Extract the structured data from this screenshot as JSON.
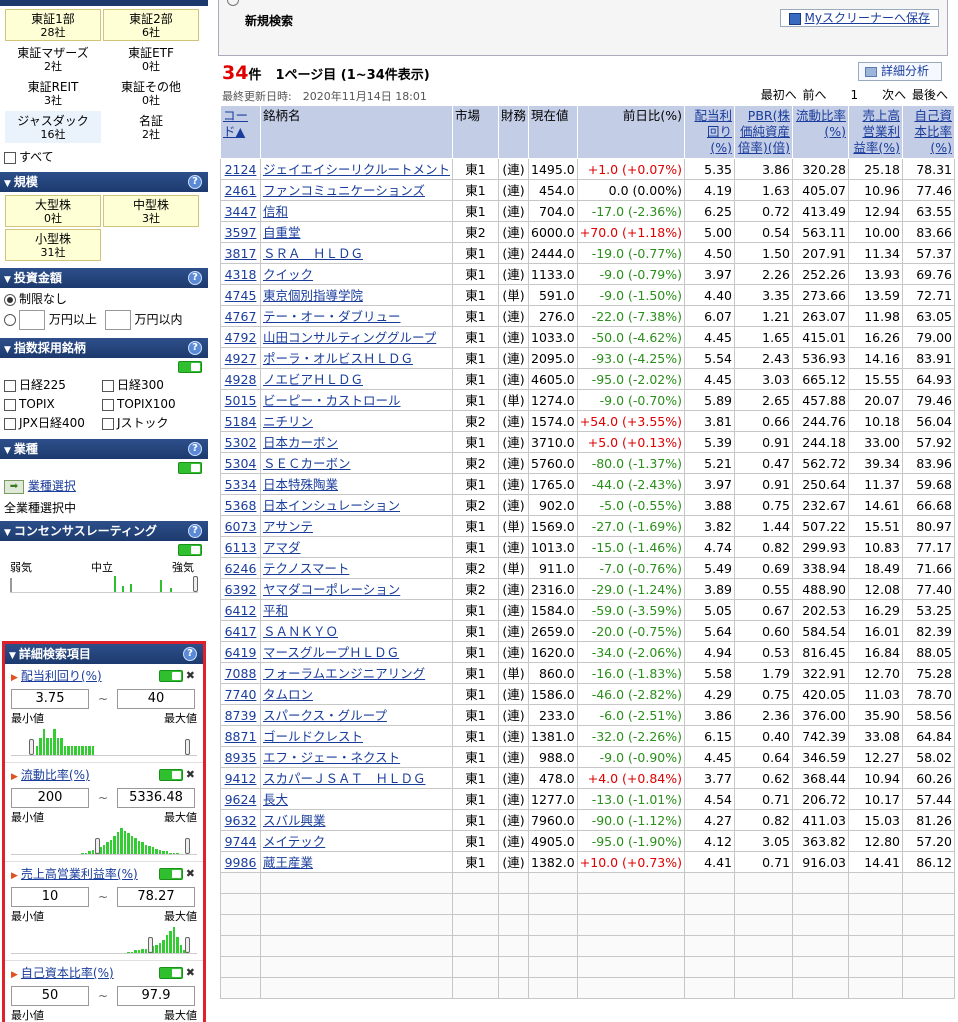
{
  "market": {
    "items": [
      {
        "name": "東証1部",
        "count": "28社",
        "sel": true
      },
      {
        "name": "東証2部",
        "count": "6社",
        "sel": true
      },
      {
        "name": "東証マザーズ",
        "count": "2社",
        "sel": false
      },
      {
        "name": "東証ETF",
        "count": "0社",
        "sel": false
      },
      {
        "name": "東証REIT",
        "count": "3社",
        "sel": false
      },
      {
        "name": "東証その他",
        "count": "0社",
        "sel": false
      },
      {
        "name": "ジャスダック",
        "count": "16社",
        "sel": false
      },
      {
        "name": "名証",
        "count": "2社",
        "sel": false
      }
    ],
    "all_label": "すべて"
  },
  "scale": {
    "title": "規模",
    "items": [
      {
        "name": "大型株",
        "count": "0社"
      },
      {
        "name": "中型株",
        "count": "3社"
      },
      {
        "name": "小型株",
        "count": "31社"
      }
    ]
  },
  "invest": {
    "title": "投資金額",
    "none_label": "制限なし",
    "min_label": "万円以上",
    "max_label": "万円以内"
  },
  "index": {
    "title": "指数採用銘柄",
    "items": [
      "日経225",
      "日経300",
      "TOPIX",
      "TOPIX100",
      "JPX日経400",
      "Jストック"
    ]
  },
  "industry": {
    "title": "業種",
    "select_label": "業種選択",
    "status": "全業種選択中"
  },
  "consensus": {
    "title": "コンセンサスレーティング",
    "weak": "弱気",
    "neutral": "中立",
    "strong": "強気"
  },
  "detail": {
    "title": "詳細検索項目",
    "min_label": "最小値",
    "max_label": "最大値",
    "items": [
      {
        "name": "配当利回り(%)",
        "min": "3.75",
        "max": "40",
        "hist": [
          0,
          0,
          0,
          0,
          0,
          0,
          0,
          1,
          2,
          3,
          2,
          2,
          3,
          2,
          2,
          1,
          1,
          1,
          1,
          1,
          1,
          1,
          1,
          1,
          0,
          0,
          0,
          0,
          0,
          0,
          0,
          0,
          0,
          0,
          0,
          0,
          0,
          0,
          0,
          0,
          0,
          0,
          0,
          0,
          0,
          0,
          0,
          0,
          0,
          0
        ],
        "lo": 0.1,
        "hi": 0.6
      },
      {
        "name": "流動比率(%)",
        "min": "200",
        "max": "5336.48",
        "hist": [
          0,
          0,
          0,
          0,
          0,
          0,
          0,
          0,
          0,
          0,
          0,
          0,
          0,
          0,
          0,
          0,
          0,
          0,
          0,
          0,
          1,
          1,
          2,
          3,
          4,
          5,
          7,
          9,
          11,
          14,
          17,
          20,
          18,
          16,
          14,
          12,
          10,
          9,
          7,
          6,
          5,
          4,
          3,
          2,
          2,
          1,
          1,
          1,
          0,
          0
        ],
        "lo": 0.48,
        "hi": 0.95
      },
      {
        "name": "売上高営業利益率(%)",
        "min": "10",
        "max": "78.27",
        "hist": [
          0,
          0,
          0,
          0,
          0,
          0,
          0,
          0,
          0,
          0,
          0,
          0,
          0,
          0,
          0,
          0,
          0,
          0,
          0,
          0,
          0,
          0,
          0,
          0,
          0,
          0,
          0,
          0,
          0,
          0,
          0,
          0,
          0,
          1,
          1,
          2,
          2,
          3,
          3,
          4,
          5,
          6,
          8,
          10,
          14,
          17,
          20,
          12,
          6,
          2
        ],
        "lo": 0.78,
        "hi": 0.96
      },
      {
        "name": "自己資本比率(%)",
        "min": "50",
        "max": "97.9",
        "hist": [],
        "lo": 0.5,
        "hi": 0.95
      }
    ]
  },
  "top": {
    "title": "新規検索",
    "save_label": "Myスクリーナーへ保存"
  },
  "result": {
    "count": "34",
    "unit": "件",
    "page": "1ページ目 (1~34件表示)",
    "updated": "最終更新日時:　2020年11月14日 18:01",
    "analysis": "詳細分析",
    "pager": "最初へ 前へ　　1　　次へ 最後へ"
  },
  "table": {
    "headers": [
      "コード▲",
      "銘柄名",
      "市場",
      "財務",
      "現在値",
      "前日比(%)",
      "配当利回り(%)",
      "PBR(株価純資産倍率)(倍)",
      "流動比率(%)",
      "売上高営業利益率(%)",
      "自己資本比率(%)"
    ],
    "rows": [
      [
        "2124",
        "ジェイエイシーリクルートメント",
        "東1",
        "(連)",
        "1495.0",
        "+1.0 (+0.07%)",
        "5.35",
        "3.86",
        "320.28",
        "25.18",
        "78.31"
      ],
      [
        "2461",
        "ファンコミュニケーションズ",
        "東1",
        "(連)",
        "454.0",
        "0.0 (0.00%)",
        "4.19",
        "1.63",
        "405.07",
        "10.96",
        "77.46"
      ],
      [
        "3447",
        "信和",
        "東1",
        "(連)",
        "704.0",
        "-17.0 (-2.36%)",
        "6.25",
        "0.72",
        "413.49",
        "12.94",
        "63.55"
      ],
      [
        "3597",
        "自重堂",
        "東2",
        "(連)",
        "6000.0",
        "+70.0 (+1.18%)",
        "5.00",
        "0.54",
        "563.11",
        "10.00",
        "83.66"
      ],
      [
        "3817",
        "ＳＲＡ　ＨＬＤＧ",
        "東1",
        "(連)",
        "2444.0",
        "-19.0 (-0.77%)",
        "4.50",
        "1.50",
        "207.91",
        "11.34",
        "57.37"
      ],
      [
        "4318",
        "クイック",
        "東1",
        "(連)",
        "1133.0",
        "-9.0 (-0.79%)",
        "3.97",
        "2.26",
        "252.26",
        "13.93",
        "69.76"
      ],
      [
        "4745",
        "東京個別指導学院",
        "東1",
        "(単)",
        "591.0",
        "-9.0 (-1.50%)",
        "4.40",
        "3.35",
        "273.66",
        "13.59",
        "72.71"
      ],
      [
        "4767",
        "テー・オー・ダブリュー",
        "東1",
        "(連)",
        "276.0",
        "-22.0 (-7.38%)",
        "6.07",
        "1.21",
        "263.07",
        "11.98",
        "63.05"
      ],
      [
        "4792",
        "山田コンサルティンググループ",
        "東1",
        "(連)",
        "1033.0",
        "-50.0 (-4.62%)",
        "4.45",
        "1.65",
        "415.01",
        "16.26",
        "79.00"
      ],
      [
        "4927",
        "ポーラ・オルビスＨＬＤＧ",
        "東1",
        "(連)",
        "2095.0",
        "-93.0 (-4.25%)",
        "5.54",
        "2.43",
        "536.93",
        "14.16",
        "83.91"
      ],
      [
        "4928",
        "ノエビアＨＬＤＧ",
        "東1",
        "(連)",
        "4605.0",
        "-95.0 (-2.02%)",
        "4.45",
        "3.03",
        "665.12",
        "15.55",
        "64.93"
      ],
      [
        "5015",
        "ビーピー・カストロール",
        "東1",
        "(単)",
        "1274.0",
        "-9.0 (-0.70%)",
        "5.89",
        "2.65",
        "457.88",
        "20.07",
        "79.46"
      ],
      [
        "5184",
        "ニチリン",
        "東2",
        "(連)",
        "1574.0",
        "+54.0 (+3.55%)",
        "3.81",
        "0.66",
        "244.76",
        "10.18",
        "56.04"
      ],
      [
        "5302",
        "日本カーボン",
        "東1",
        "(連)",
        "3710.0",
        "+5.0 (+0.13%)",
        "5.39",
        "0.91",
        "244.18",
        "33.00",
        "57.92"
      ],
      [
        "5304",
        "ＳＥＣカーボン",
        "東2",
        "(連)",
        "5760.0",
        "-80.0 (-1.37%)",
        "5.21",
        "0.47",
        "562.72",
        "39.34",
        "83.96"
      ],
      [
        "5334",
        "日本特殊陶業",
        "東1",
        "(連)",
        "1765.0",
        "-44.0 (-2.43%)",
        "3.97",
        "0.91",
        "250.64",
        "11.37",
        "59.68"
      ],
      [
        "5368",
        "日本インシュレーション",
        "東2",
        "(連)",
        "902.0",
        "-5.0 (-0.55%)",
        "3.88",
        "0.75",
        "232.67",
        "14.61",
        "66.68"
      ],
      [
        "6073",
        "アサンテ",
        "東1",
        "(単)",
        "1569.0",
        "-27.0 (-1.69%)",
        "3.82",
        "1.44",
        "507.22",
        "15.51",
        "80.97"
      ],
      [
        "6113",
        "アマダ",
        "東1",
        "(連)",
        "1013.0",
        "-15.0 (-1.46%)",
        "4.74",
        "0.82",
        "299.93",
        "10.83",
        "77.17"
      ],
      [
        "6246",
        "テクノスマート",
        "東2",
        "(単)",
        "911.0",
        "-7.0 (-0.76%)",
        "5.49",
        "0.69",
        "338.94",
        "18.49",
        "71.66"
      ],
      [
        "6392",
        "ヤマダコーポレーション",
        "東2",
        "(連)",
        "2316.0",
        "-29.0 (-1.24%)",
        "3.89",
        "0.55",
        "488.90",
        "12.08",
        "77.40"
      ],
      [
        "6412",
        "平和",
        "東1",
        "(連)",
        "1584.0",
        "-59.0 (-3.59%)",
        "5.05",
        "0.67",
        "202.53",
        "16.29",
        "53.25"
      ],
      [
        "6417",
        "ＳＡＮＫＹＯ",
        "東1",
        "(連)",
        "2659.0",
        "-20.0 (-0.75%)",
        "5.64",
        "0.60",
        "584.54",
        "16.01",
        "82.39"
      ],
      [
        "6419",
        "マースグループＨＬＤＧ",
        "東1",
        "(連)",
        "1620.0",
        "-34.0 (-2.06%)",
        "4.94",
        "0.53",
        "816.45",
        "16.84",
        "88.05"
      ],
      [
        "7088",
        "フォーラムエンジニアリング",
        "東1",
        "(単)",
        "860.0",
        "-16.0 (-1.83%)",
        "5.58",
        "1.79",
        "322.91",
        "12.70",
        "75.28"
      ],
      [
        "7740",
        "タムロン",
        "東1",
        "(連)",
        "1586.0",
        "-46.0 (-2.82%)",
        "4.29",
        "0.75",
        "420.05",
        "11.03",
        "78.70"
      ],
      [
        "8739",
        "スパークス・グループ",
        "東1",
        "(連)",
        "233.0",
        "-6.0 (-2.51%)",
        "3.86",
        "2.36",
        "376.00",
        "35.90",
        "58.56"
      ],
      [
        "8871",
        "ゴールドクレスト",
        "東1",
        "(連)",
        "1381.0",
        "-32.0 (-2.26%)",
        "6.15",
        "0.40",
        "742.39",
        "33.08",
        "64.84"
      ],
      [
        "8935",
        "エフ・ジェー・ネクスト",
        "東1",
        "(連)",
        "988.0",
        "-9.0 (-0.90%)",
        "4.45",
        "0.64",
        "346.59",
        "12.27",
        "58.02"
      ],
      [
        "9412",
        "スカパーＪＳＡＴ　ＨＬＤＧ",
        "東1",
        "(連)",
        "478.0",
        "+4.0 (+0.84%)",
        "3.77",
        "0.62",
        "368.44",
        "10.94",
        "60.26"
      ],
      [
        "9624",
        "長大",
        "東1",
        "(連)",
        "1277.0",
        "-13.0 (-1.01%)",
        "4.54",
        "0.71",
        "206.72",
        "10.17",
        "57.44"
      ],
      [
        "9632",
        "スバル興業",
        "東1",
        "(連)",
        "7960.0",
        "-90.0 (-1.12%)",
        "4.27",
        "0.82",
        "411.03",
        "15.03",
        "81.26"
      ],
      [
        "9744",
        "メイテック",
        "東1",
        "(連)",
        "4905.0",
        "-95.0 (-1.90%)",
        "4.12",
        "3.05",
        "363.82",
        "12.80",
        "57.20"
      ],
      [
        "9986",
        "蔵王産業",
        "東1",
        "(連)",
        "1382.0",
        "+10.0 (+0.73%)",
        "4.41",
        "0.71",
        "916.03",
        "14.41",
        "86.12"
      ]
    ]
  }
}
